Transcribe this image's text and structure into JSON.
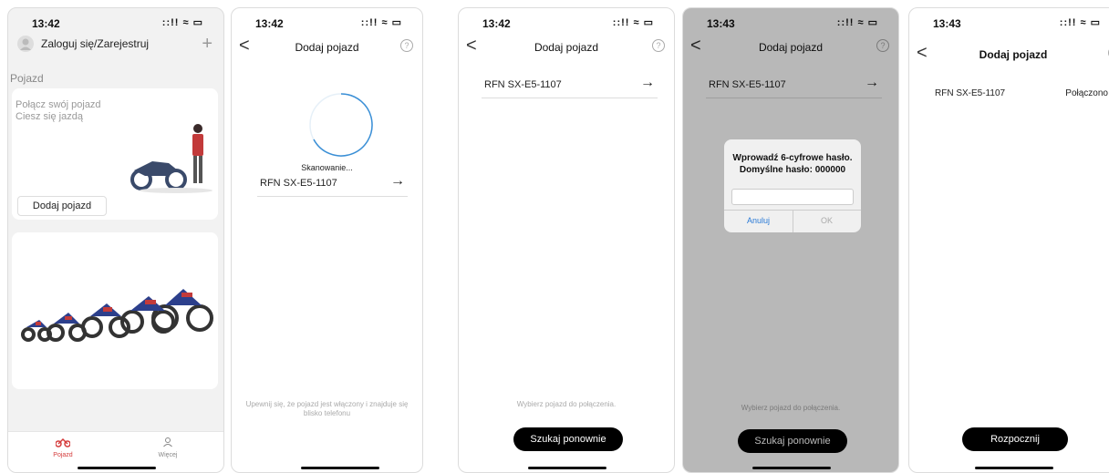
{
  "status": {
    "time1": "13:42",
    "time2": "13:43",
    "icons": "::!! ≈ ▭"
  },
  "home": {
    "login": "Zaloguj się/Zarejestruj",
    "plus": "+",
    "section": "Pojazd",
    "card_line1": "Połącz swój pojazd",
    "card_line2": "Ciesz się jazdą",
    "add_button": "Dodaj pojazd",
    "tab_vehicle": "Pojazd",
    "tab_more": "Więcej"
  },
  "nav": {
    "title": "Dodaj pojazd",
    "back": "<",
    "help": "?"
  },
  "scan": {
    "scanning": "Skanowanie...",
    "device": "RFN SX-E5-1107",
    "arrow": "→",
    "hint": "Upewnij się, że pojazd jest włączony i znajduje się blisko telefonu"
  },
  "select": {
    "hint": "Wybierz pojazd do połączenia.",
    "rescan": "Szukaj ponownie"
  },
  "dialog": {
    "line1": "Wprowadź 6-cyfrowe hasło.",
    "line2": "Domyślne hasło: 000000",
    "cancel": "Anuluj",
    "ok": "OK"
  },
  "connected": {
    "status": "Połączono",
    "start": "Rozpocznij"
  },
  "colors": {
    "accent": "#d43a3a",
    "link": "#2a7ad6",
    "spinner": "#3a8fd6"
  }
}
